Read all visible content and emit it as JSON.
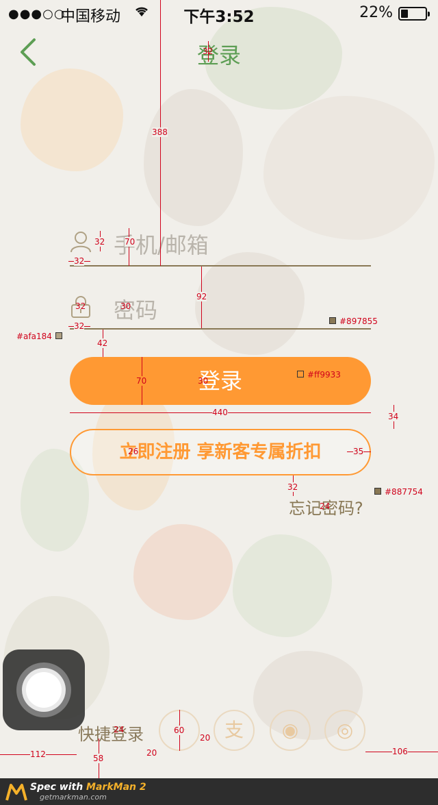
{
  "status_bar": {
    "signal": "●●●○○",
    "carrier": "中国移动",
    "time": "下午3:52",
    "battery": "22%"
  },
  "nav": {
    "title": "登录"
  },
  "form": {
    "account_placeholder": "手机/邮箱",
    "password_placeholder": "密码",
    "login_label": "登录",
    "register_label": "立即注册 享新客专属折扣",
    "forgot_label": "忘记密码?"
  },
  "quick_login": {
    "label": "快捷登录",
    "options": [
      {
        "name": "qq",
        "glyph": "✦"
      },
      {
        "name": "alipay",
        "glyph": "支"
      },
      {
        "name": "weibo",
        "glyph": "◉"
      },
      {
        "name": "wechat",
        "glyph": "◎"
      }
    ]
  },
  "footer": {
    "line1_prefix": "Spec with ",
    "line1_brand": "MarkMan 2",
    "line2": "getmarkman.com"
  },
  "annotations": {
    "m32_title": "32",
    "m388": "388",
    "m32_icon1": "32",
    "m70": "70",
    "m32_iconw1": "32",
    "m92": "92",
    "m32_icon2": "32",
    "m30_text": "30",
    "m32_iconw2": "32",
    "m42": "42",
    "m70_btn": "70",
    "m30_btn": "30",
    "m440": "440",
    "m34": "34",
    "m26": "26",
    "m35": "35",
    "m32_gap": "32",
    "m24_forgot": "24",
    "m24_quick": "24",
    "m60": "60",
    "m20a": "20",
    "m20b": "20",
    "m112": "112",
    "m58": "58",
    "m106": "106",
    "c_line": "#897855",
    "c_icon": "#afa184",
    "c_btn": "#ff9933",
    "c_forgot": "#887754"
  },
  "colors": {
    "accent": "#ff9933",
    "title_green": "#5d9e54",
    "underline": "#897855",
    "icon": "#afa184",
    "forgot": "#887754"
  }
}
